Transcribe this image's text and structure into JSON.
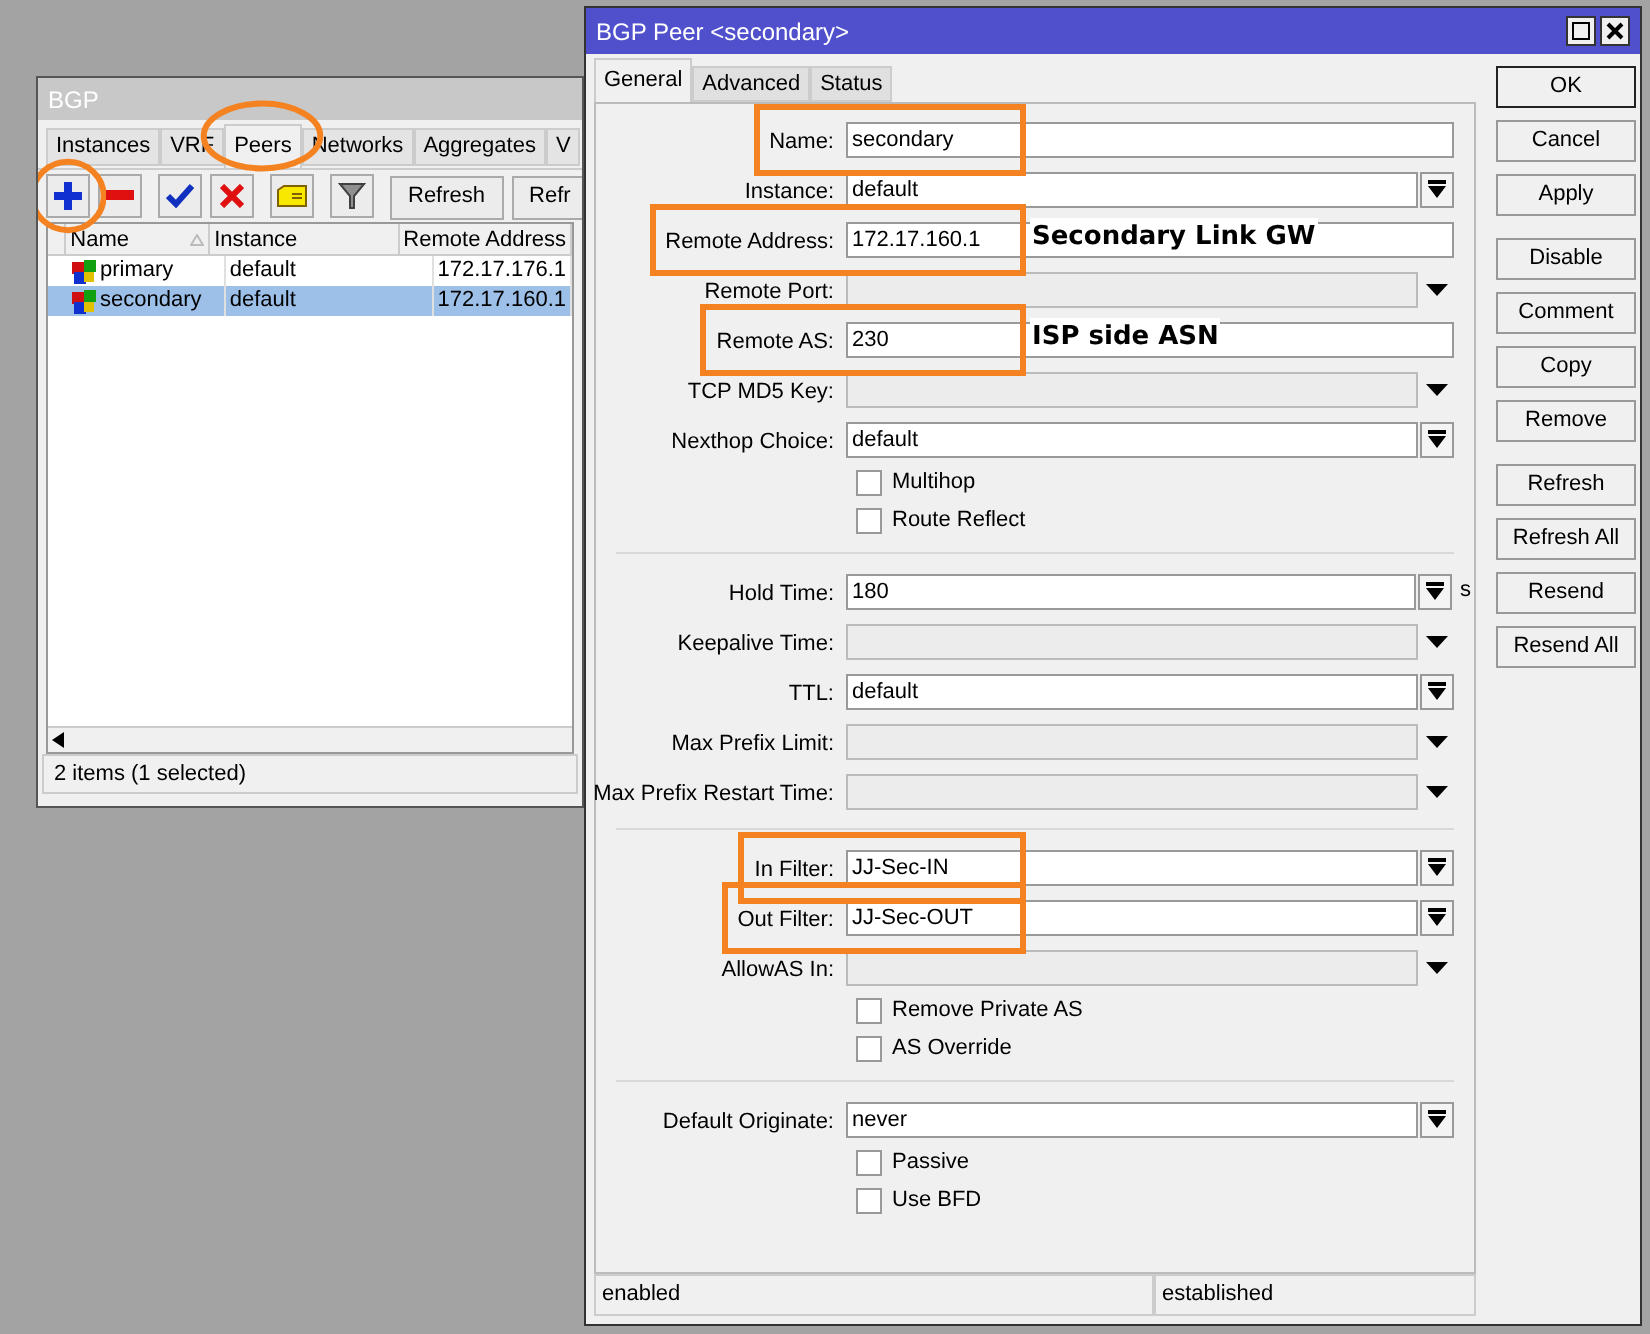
{
  "bgp_window": {
    "title": "BGP",
    "tabs": [
      {
        "label": "Instances",
        "selected": false,
        "circled": false
      },
      {
        "label": "VRF",
        "selected": false,
        "circled": false
      },
      {
        "label": "Peers",
        "selected": true,
        "circled": true
      },
      {
        "label": "Networks",
        "selected": false,
        "circled": false
      },
      {
        "label": "Aggregates",
        "selected": false,
        "circled": false
      },
      {
        "label": "V",
        "selected": false,
        "circled": false
      }
    ],
    "toolbar": [
      {
        "kind": "add",
        "circled": true
      },
      {
        "kind": "remove",
        "circled": false
      },
      {
        "kind": "enable",
        "circled": false
      },
      {
        "kind": "disable",
        "circled": false
      },
      {
        "kind": "comment",
        "circled": false
      },
      {
        "kind": "filter",
        "circled": false
      },
      {
        "kind": "text",
        "label": "Refresh",
        "circled": false
      },
      {
        "kind": "text",
        "label": "Refr",
        "circled": false
      }
    ],
    "table": {
      "columns": [
        "Name",
        "Instance",
        "Remote Address"
      ],
      "rows": [
        {
          "cells": [
            "primary",
            "default",
            "172.17.176.1"
          ],
          "selected": false
        },
        {
          "cells": [
            "secondary",
            "default",
            "172.17.160.1"
          ],
          "selected": true
        }
      ]
    },
    "status_bar": "2 items (1 selected)"
  },
  "peer_dialog": {
    "title": "BGP Peer <secondary>",
    "tabs": [
      {
        "label": "General",
        "selected": true
      },
      {
        "label": "Advanced",
        "selected": false
      },
      {
        "label": "Status",
        "selected": false
      }
    ],
    "form": [
      {
        "kind": "text-field",
        "label": "Name:",
        "value": "secondary",
        "highlighted": true
      },
      {
        "kind": "select-field",
        "label": "Instance:",
        "value": "default",
        "highlighted": false
      },
      {
        "kind": "text-field",
        "label": "Remote Address:",
        "value": "172.17.160.1",
        "highlighted": true,
        "note": "Secondary Link GW"
      },
      {
        "kind": "optional-field",
        "label": "Remote Port:",
        "highlighted": false
      },
      {
        "kind": "text-field",
        "label": "Remote AS:",
        "value": "230",
        "highlighted": true,
        "note": "ISP side ASN"
      },
      {
        "kind": "optional-field",
        "label": "TCP MD5 Key:",
        "highlighted": false
      },
      {
        "kind": "select-field",
        "label": "Nexthop Choice:",
        "value": "default",
        "highlighted": false
      },
      {
        "kind": "check",
        "label": "Multihop",
        "checked": false
      },
      {
        "kind": "check",
        "label": "Route Reflect",
        "checked": false
      },
      {
        "kind": "separator"
      },
      {
        "kind": "select-field",
        "label": "Hold Time:",
        "value": "180",
        "unit": "s",
        "highlighted": false
      },
      {
        "kind": "optional-field",
        "label": "Keepalive Time:",
        "highlighted": false
      },
      {
        "kind": "select-field",
        "label": "TTL:",
        "value": "default",
        "highlighted": false
      },
      {
        "kind": "optional-field",
        "label": "Max Prefix Limit:",
        "highlighted": false
      },
      {
        "kind": "optional-field",
        "label": "Max Prefix Restart Time:",
        "highlighted": false
      },
      {
        "kind": "separator"
      },
      {
        "kind": "select-field",
        "label": "In Filter:",
        "value": "JJ-Sec-IN",
        "highlighted": true
      },
      {
        "kind": "select-field",
        "label": "Out Filter:",
        "value": "JJ-Sec-OUT",
        "highlighted": true
      },
      {
        "kind": "optional-field",
        "label": "AllowAS In:",
        "highlighted": false
      },
      {
        "kind": "check",
        "label": "Remove Private AS",
        "checked": false
      },
      {
        "kind": "check",
        "label": "AS Override",
        "checked": false
      },
      {
        "kind": "separator"
      },
      {
        "kind": "select-field",
        "label": "Default Originate:",
        "value": "never",
        "highlighted": false
      },
      {
        "kind": "check",
        "label": "Passive",
        "checked": false
      },
      {
        "kind": "check",
        "label": "Use BFD",
        "checked": false
      }
    ],
    "button_groups": [
      [
        {
          "label": "OK",
          "default": true
        },
        {
          "label": "Cancel",
          "default": false
        },
        {
          "label": "Apply",
          "default": false
        }
      ],
      [
        {
          "label": "Disable",
          "default": false
        },
        {
          "label": "Comment",
          "default": false
        },
        {
          "label": "Copy",
          "default": false
        },
        {
          "label": "Remove",
          "default": false
        }
      ],
      [
        {
          "label": "Refresh",
          "default": false
        },
        {
          "label": "Refresh All",
          "default": false
        },
        {
          "label": "Resend",
          "default": false
        },
        {
          "label": "Resend All",
          "default": false
        }
      ]
    ],
    "status_bar": [
      "enabled",
      "established"
    ]
  }
}
